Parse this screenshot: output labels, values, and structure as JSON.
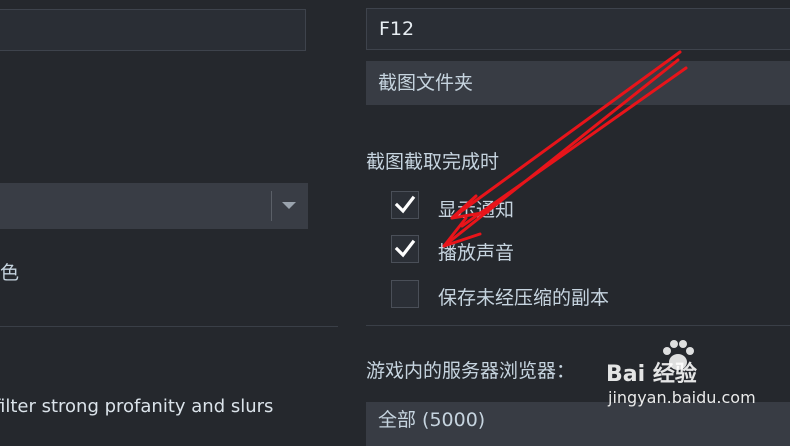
{
  "left": {
    "top_input": {
      "value": ""
    },
    "dropdown": {
      "value": ""
    },
    "color_label_partial": "色",
    "filter_text_partial": "filter strong profanity and slurs"
  },
  "right": {
    "hotkey_input": {
      "value": "F12"
    },
    "screenshot_folder_button": "截图文件夹",
    "section_title": "截图截取完成时",
    "options": [
      {
        "label": "显示通知",
        "checked": true
      },
      {
        "label": "播放声音",
        "checked": true
      },
      {
        "label": "保存未经压缩的副本",
        "checked": false
      }
    ],
    "server_browser_label": "游戏内的服务器浏览器：",
    "bottom_select_partial": "全部 (5000)"
  },
  "watermark": {
    "brand": "Bai 经验",
    "url": "jingyan.baidu.com"
  },
  "colors": {
    "background": "#25282d",
    "arrow": "#e8141a",
    "check": "#ffffff"
  },
  "icons": [
    "checkmark-icon",
    "chevron-down-icon",
    "paw-icon"
  ]
}
